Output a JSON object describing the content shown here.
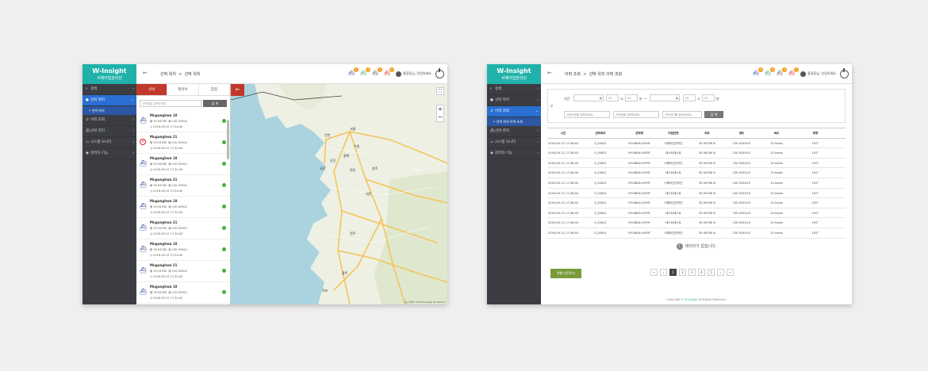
{
  "brand": {
    "title": "W-Insight",
    "subtitle": "서해어업관리단",
    "accent": "#20b2aa"
  },
  "menu": {
    "items": [
      "검색",
      "선박 위치",
      "이력 조회",
      "선박 관리",
      "시스템 모니터",
      "관리자 기능"
    ],
    "sub_location": "선박 위치",
    "sub_history": "선박 위치 이력 조회"
  },
  "header1": {
    "crumb1": "선박 위치",
    "sep": ">",
    "crumb2": "선박 위치"
  },
  "header2": {
    "crumb1": "이력 조회",
    "sep": ">",
    "crumb2": "선박 위치 이력 조회"
  },
  "toolbar": {
    "badges": [
      "2",
      "4",
      "1",
      "2"
    ],
    "user": "홍길동님, 안녕하세요."
  },
  "panel": {
    "tabs": [
      "선박",
      "레이어",
      "장점"
    ],
    "search_placeholder": "선박명을 입력하세요.",
    "search_label": "검 색",
    "ships": [
      {
        "name": "Mugunghwa 18",
        "lat": "35.94780",
        "lon": "130.92504",
        "time": "2016-09-12 17:24:40",
        "state": "ship"
      },
      {
        "name": "Mugunghwa 21",
        "lat": "35.94780",
        "lon": "130.92504",
        "time": "2016-09-12 17:24:40",
        "state": "x"
      },
      {
        "name": "Mugunghwa 18",
        "lat": "35.94780",
        "lon": "130.92504",
        "time": "2016-09-12 17:24:40",
        "state": "ship"
      },
      {
        "name": "Mugunghwa 21",
        "lat": "35.94780",
        "lon": "130.92504",
        "time": "2016-09-12 17:24:40",
        "state": "ship"
      },
      {
        "name": "Mugunghwa 18",
        "lat": "35.94780",
        "lon": "130.92504",
        "time": "2016-09-12 17:24:40",
        "state": "ship"
      },
      {
        "name": "Mugunghwa 21",
        "lat": "35.94780",
        "lon": "130.92504",
        "time": "2016-09-12 17:24:40",
        "state": "ship"
      },
      {
        "name": "Mugunghwa 18",
        "lat": "35.94780",
        "lon": "130.92504",
        "time": "2016-09-12 17:24:40",
        "state": "ship"
      },
      {
        "name": "Mugunghwa 21",
        "lat": "35.94780",
        "lon": "130.92504",
        "time": "2016-09-12 17:24:40",
        "state": "ship"
      },
      {
        "name": "Mugunghwa 18",
        "lat": "35.94780",
        "lon": "130.92504",
        "time": "2016-09-12 17:24:40",
        "state": "ship"
      }
    ]
  },
  "map": {
    "places": [
      "서울",
      "인천",
      "수원",
      "천안",
      "청주",
      "대전",
      "전주",
      "광주",
      "목포",
      "평택",
      "당진",
      "서산"
    ],
    "copyright": "지도 데이터 ©2016 Google, SK telecom"
  },
  "filter": {
    "period_label": "기간",
    "hour_unit": "시",
    "min_unit": "분",
    "tilde": "~",
    "hour_val": "00",
    "min_val": "00",
    "ph_business": "사업단명을 입력하세요.",
    "ph_ship": "선박명을 입력하세요.",
    "ph_code": "선박코드를 입력하세요.",
    "search_label": "검 색"
  },
  "table": {
    "headers": [
      "시간",
      "선박코드",
      "선박명",
      "어업단명",
      "위도",
      "경도",
      "속도",
      "방향"
    ],
    "rows": [
      [
        "2016-09-12 17:28:40",
        "S_00001",
        "HYUNDAI HOPE",
        "서해어업관리단",
        "35.94780 N",
        "130.92504 E",
        "15 knots",
        "192°"
      ],
      [
        "2016-09-12 17:28:40",
        "S_00001",
        "HYUNDAI HOPE",
        "테스트테스트",
        "35.94780 N",
        "130.92504 E",
        "15 knots",
        "192°"
      ],
      [
        "2016-09-12 17:28:40",
        "S_00001",
        "HYUNDAI HOPE",
        "서해어업관리단",
        "35.94780 N",
        "130.92504 E",
        "15 knots",
        "192°"
      ],
      [
        "2016-09-12 17:28:40",
        "S_00001",
        "HYUNDAI HOPE",
        "테스트테스트",
        "35.94780 N",
        "130.92504 E",
        "15 knots",
        "192°"
      ],
      [
        "2016-09-12 17:28:40",
        "S_00001",
        "HYUNDAI HOPE",
        "서해어업관리단",
        "35.94780 N",
        "130.92504 E",
        "15 knots",
        "192°"
      ],
      [
        "2016-09-12 17:28:40",
        "S_00001",
        "HYUNDAI HOPE",
        "테스트테스트",
        "35.94780 N",
        "130.92504 E",
        "15 knots",
        "192°"
      ],
      [
        "2016-09-12 17:28:40",
        "S_00001",
        "HYUNDAI HOPE",
        "서해어업관리단",
        "35.94780 N",
        "130.92504 E",
        "15 knots",
        "192°"
      ],
      [
        "2016-09-12 17:28:40",
        "S_00001",
        "HYUNDAI HOPE",
        "테스트테스트",
        "35.94780 N",
        "130.92504 E",
        "15 knots",
        "192°"
      ],
      [
        "2016-09-12 17:28:40",
        "S_00001",
        "HYUNDAI HOPE",
        "테스트테스트",
        "35.94780 N",
        "130.92504 E",
        "15 knots",
        "192°"
      ],
      [
        "2016-09-12 17:28:40",
        "S_00001",
        "HYUNDAI HOPE",
        "서해어업관리단",
        "35.94780 N",
        "130.92504 E",
        "15 knots",
        "192°"
      ]
    ]
  },
  "nodata": "데이터가 없습니다.",
  "excel": "엑셀 다운로드",
  "pager": [
    "«",
    "‹",
    "1",
    "2",
    "3",
    "4",
    "5",
    "›",
    "»"
  ],
  "copyright": {
    "pre": "Copyright ©",
    "brand": "W-Insight",
    "post": "All Rights Reserved."
  }
}
